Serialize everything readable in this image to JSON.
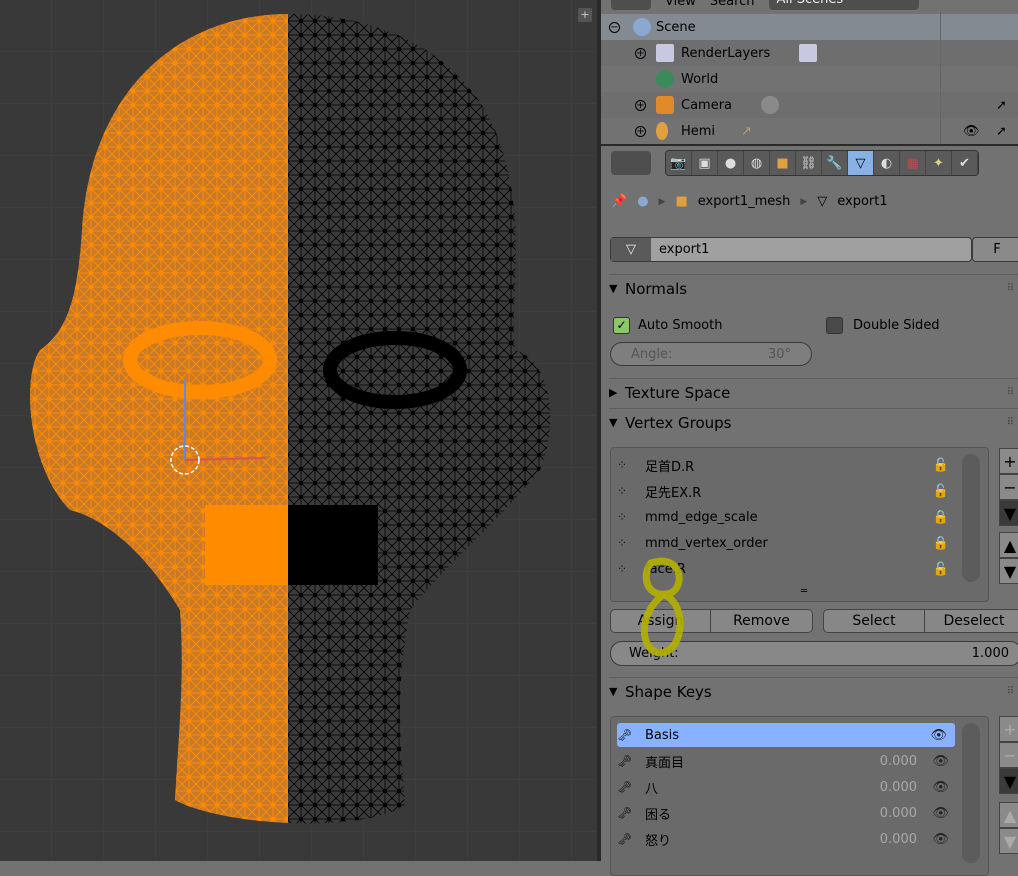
{
  "outliner": {
    "header": {
      "view": "View",
      "search": "Search",
      "scenes": "All Scenes"
    },
    "items": [
      {
        "label": "Scene",
        "icon": "scene-icon"
      },
      {
        "label": "RenderLayers",
        "icon": "renderlayers-icon"
      },
      {
        "label": "World",
        "icon": "world-icon"
      },
      {
        "label": "Camera",
        "icon": "camera-icon"
      },
      {
        "label": "Hemi",
        "icon": "lamp-icon"
      }
    ]
  },
  "properties": {
    "tabs": [
      "render",
      "render-layers",
      "scene",
      "world",
      "object",
      "constraints",
      "modifiers",
      "data",
      "material",
      "texture",
      "particles",
      "physics"
    ],
    "active_tab": "data",
    "breadcrumb": {
      "object": "export1_mesh",
      "data": "export1"
    },
    "datablock": {
      "name": "export1",
      "fake_user": "F"
    },
    "normals": {
      "title": "Normals",
      "auto_smooth": "Auto Smooth",
      "auto_smooth_checked": true,
      "double_sided": "Double Sided",
      "double_sided_checked": false,
      "angle_label": "Angle:",
      "angle_value": "30°"
    },
    "texture_space": {
      "title": "Texture Space"
    },
    "vertex_groups": {
      "title": "Vertex Groups",
      "items": [
        {
          "name": "足首D.R",
          "locked": false
        },
        {
          "name": "足先EX.R",
          "locked": false
        },
        {
          "name": "mmd_edge_scale",
          "locked": true
        },
        {
          "name": "mmd_vertex_order",
          "locked": true
        },
        {
          "name": "face.R",
          "locked": false
        }
      ],
      "assign": "Assign",
      "remove": "Remove",
      "select": "Select",
      "deselect": "Deselect",
      "weight_label": "Weight:",
      "weight_value": "1.000"
    },
    "shape_keys": {
      "title": "Shape Keys",
      "items": [
        {
          "name": "Basis",
          "value": "",
          "selected": true
        },
        {
          "name": "真面目",
          "value": "0.000"
        },
        {
          "name": "八",
          "value": "0.000"
        },
        {
          "name": "困る",
          "value": "0.000"
        },
        {
          "name": "怒り",
          "value": "0.000"
        }
      ]
    }
  },
  "colors": {
    "selection_orange": "#ff8c00",
    "active_blue": "#88b2e4",
    "annotation_yellow": "#b5b000"
  }
}
